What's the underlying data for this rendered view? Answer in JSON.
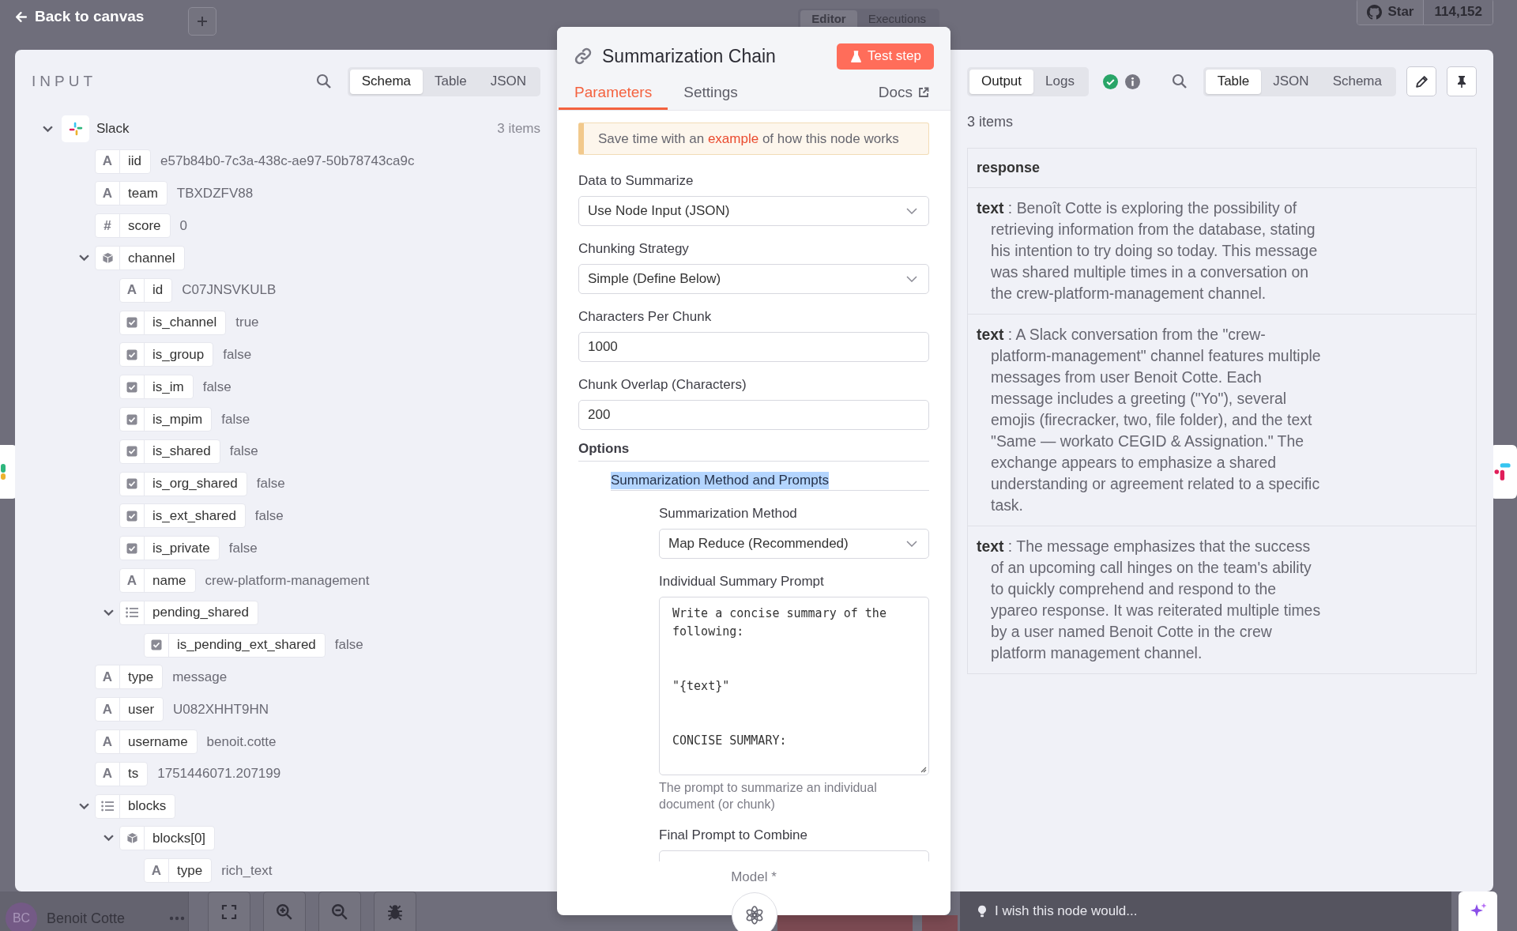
{
  "top_bar": {
    "back_label": "Back to canvas",
    "canvas_tabs": [
      {
        "label": "Editor",
        "selected": true
      },
      {
        "label": "Executions",
        "selected": false
      }
    ],
    "github": {
      "label": "Star",
      "count": "114,152"
    }
  },
  "input_panel": {
    "title": "INPUT",
    "view_tabs": [
      {
        "label": "Schema",
        "selected": true
      },
      {
        "label": "Table",
        "selected": false
      },
      {
        "label": "JSON",
        "selected": false
      }
    ],
    "tree": {
      "label": "Slack",
      "count": "3 items",
      "expanded": true,
      "children": [
        {
          "kind": "string",
          "icon": "A",
          "key": "iid",
          "value": "e57b84b0-7c3a-438c-ae97-50b78743ca9c"
        },
        {
          "kind": "string",
          "icon": "A",
          "key": "team",
          "value": "TBXDZFV88"
        },
        {
          "kind": "number",
          "icon": "#",
          "key": "score",
          "value": "0"
        },
        {
          "kind": "object",
          "key": "channel",
          "expanded": true,
          "children": [
            {
              "kind": "string",
              "icon": "A",
              "key": "id",
              "value": "C07JNSVKULB"
            },
            {
              "kind": "boolean",
              "key": "is_channel",
              "value": "true"
            },
            {
              "kind": "boolean",
              "key": "is_group",
              "value": "false"
            },
            {
              "kind": "boolean",
              "key": "is_im",
              "value": "false"
            },
            {
              "kind": "boolean",
              "key": "is_mpim",
              "value": "false"
            },
            {
              "kind": "boolean",
              "key": "is_shared",
              "value": "false"
            },
            {
              "kind": "boolean",
              "key": "is_org_shared",
              "value": "false"
            },
            {
              "kind": "boolean",
              "key": "is_ext_shared",
              "value": "false"
            },
            {
              "kind": "boolean",
              "key": "is_private",
              "value": "false"
            },
            {
              "kind": "string",
              "icon": "A",
              "key": "name",
              "value": "crew-platform-management"
            },
            {
              "kind": "array",
              "key": "pending_shared",
              "expanded": true,
              "children": [
                {
                  "kind": "boolean",
                  "key": "is_pending_ext_shared",
                  "value": "false"
                }
              ]
            }
          ]
        },
        {
          "kind": "string",
          "icon": "A",
          "key": "type",
          "value": "message"
        },
        {
          "kind": "string",
          "icon": "A",
          "key": "user",
          "value": "U082XHHT9HN"
        },
        {
          "kind": "string",
          "icon": "A",
          "key": "username",
          "value": "benoit.cotte"
        },
        {
          "kind": "string",
          "icon": "A",
          "key": "ts",
          "value": "1751446071.207199"
        },
        {
          "kind": "array",
          "key": "blocks",
          "expanded": true,
          "children": [
            {
              "kind": "object",
              "key": "blocks[0]",
              "expanded": true,
              "children": [
                {
                  "kind": "string",
                  "icon": "A",
                  "key": "type",
                  "value": "rich_text"
                }
              ]
            }
          ]
        }
      ]
    }
  },
  "node": {
    "title": "Summarization Chain",
    "test_button": "Test step",
    "tabs": [
      {
        "label": "Parameters",
        "selected": true
      },
      {
        "label": "Settings",
        "selected": false
      }
    ],
    "docs_label": "Docs",
    "notice": {
      "before": "Save time with an",
      "link": "example",
      "after": "of how this node works"
    },
    "fields": [
      {
        "kind": "select",
        "label": "Data to Summarize",
        "value": "Use Node Input (JSON)"
      },
      {
        "kind": "select",
        "label": "Chunking Strategy",
        "value": "Simple (Define Below)"
      },
      {
        "kind": "number",
        "label": "Characters Per Chunk",
        "value": "1000"
      },
      {
        "kind": "number",
        "label": "Chunk Overlap (Characters)",
        "value": "200"
      }
    ],
    "options": {
      "label": "Options",
      "collection": {
        "label": "Summarization Method and Prompts",
        "highlighted": true,
        "fields": [
          {
            "kind": "select",
            "label": "Summarization Method",
            "value": "Map Reduce (Recommended)"
          },
          {
            "kind": "textarea",
            "label": "Individual Summary Prompt",
            "value": "Write a concise summary of the following:\n\n\n\"{text}\"\n\n\nCONCISE SUMMARY:",
            "hint": "The prompt to summarize an individual document (or chunk)"
          },
          {
            "kind": "textarea",
            "label": "Final Prompt to Combine"
          }
        ]
      }
    },
    "model_label": "Model *"
  },
  "output_panel": {
    "tabs": [
      {
        "label": "Output",
        "selected": true
      },
      {
        "label": "Logs",
        "selected": false
      }
    ],
    "success": true,
    "view_tabs": [
      {
        "label": "Table",
        "selected": true
      },
      {
        "label": "JSON",
        "selected": false
      },
      {
        "label": "Schema",
        "selected": false
      }
    ],
    "count": "3 items",
    "column": "response",
    "rows": [
      "**text** : Benoît Cotte is exploring the possibility of retrieving information from the database, stating his intention to try doing so today. This message was shared multiple times in a conversation on the crew-platform-management channel.",
      "**text** : A Slack conversation from the \"crew-platform-management\" channel features multiple messages from user Benoit Cotte. Each message includes a greeting (\"Yo\"), several emojis (firecracker, two, file folder), and the text \"Same — workato CEGID & Assignation.\" The exchange appears to emphasize a shared understanding or agreement related to a specific task.",
      "**text** : The message emphasizes that the success of an upcoming call hinges on the team's ability to quickly comprehend and respond to the ypareo response. It was reiterated multiple times by a user named Benoit Cotte in the crew platform management channel."
    ],
    "feedback_placeholder": "I wish this node would..."
  },
  "bottom_bar": {
    "user": {
      "initials": "BC",
      "name": "Benoit Cotte"
    }
  }
}
